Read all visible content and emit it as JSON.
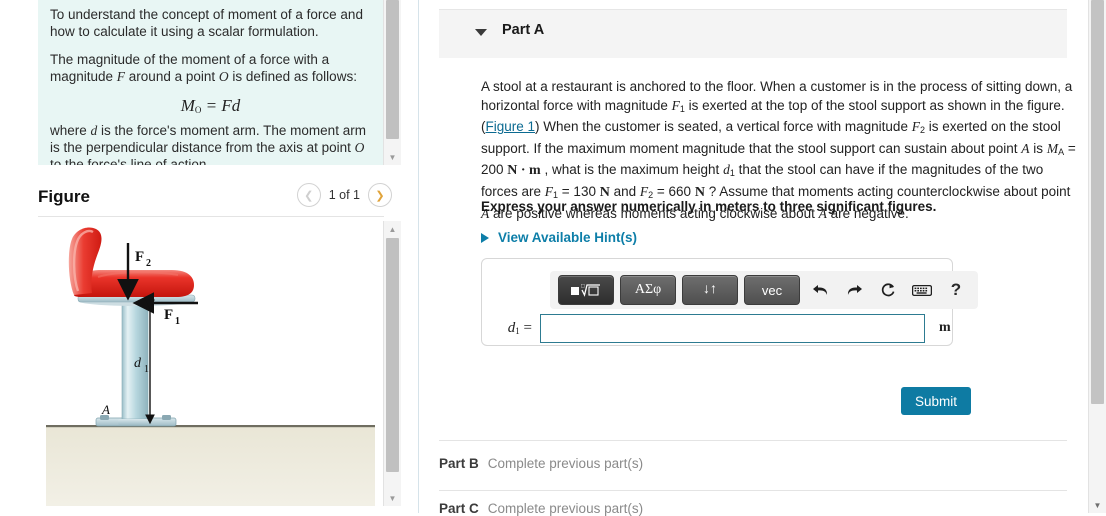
{
  "intro": {
    "objective": "To understand the concept of moment of a force and how to calculate it using a scalar formulation.",
    "definition_pre": "The magnitude of the moment of a force with a magnitude ",
    "definition_F": "F",
    "definition_mid": " around a point ",
    "definition_O": "O",
    "definition_post": " is defined as follows:",
    "equation": "M_O = Fd",
    "equation_M": "M",
    "equation_Osub": "O",
    "equation_rhs": "= Fd",
    "explanation_1": "where ",
    "explanation_d": "d",
    "explanation_2": " is the force's moment arm. The moment arm is the perpendicular distance from the axis at point ",
    "explanation_O": "O",
    "explanation_3": " to the force's line of action."
  },
  "figure": {
    "title": "Figure",
    "pager_label": "1 of 1",
    "prev_icon": "chevron-left-icon",
    "next_icon": "chevron-right-icon",
    "labels": {
      "force_2": "F",
      "force_2_sub": "2",
      "force_1": "F",
      "force_1_sub": "1",
      "distance": "d",
      "distance_sub": "1",
      "point": "A"
    },
    "colors": {
      "seat": "#e8291f",
      "seat_highlight": "#f06a60",
      "post": "#b9d8e0",
      "post_edge": "#8fb8c4",
      "floor": "#e6e3d3",
      "floor_line": "#7d7b6e"
    }
  },
  "partA": {
    "header_label": "Part A",
    "caret_icon": "caret-down-icon",
    "problem": {
      "s1": "A stool at a restaurant is anchored to the floor. When a customer is in the process of sitting down, a horizontal force with magnitude ",
      "F1a": "F",
      "F1a_sub": "1",
      "s2": " is exerted at the top of the stool support as shown in the figure. (",
      "figure_link": "Figure 1",
      "s3": ") When the customer is seated, a vertical force with magnitude ",
      "F2a": "F",
      "F2a_sub": "2",
      "s4": " is exerted on the stool support. If the maximum moment magnitude that the stool support can sustain about point ",
      "A1": "A",
      "s5": " is ",
      "MA": "M",
      "MA_sub": "A",
      "s6": " = 200 ",
      "unit_Nm": "N · m",
      "s7": " , what is the maximum height ",
      "d1": "d",
      "d1_sub": "1",
      "s8": " that the stool can have if the magnitudes of the two forces are ",
      "F1b": "F",
      "F1b_sub": "1",
      "s9": " = 130 ",
      "unit_N1": "N",
      "s10": " and ",
      "F2b": "F",
      "F2b_sub": "2",
      "s11": " = 660 ",
      "unit_N2": "N",
      "s12": " ?  Assume that moments acting counterclockwise about point ",
      "A2": "A",
      "s13": " are positive whereas moments acting clockwise about ",
      "A3": "A",
      "s14": " are negative."
    },
    "instruction": "Express your answer numerically in meters to three significant figures.",
    "hints_label": "View Available Hint(s)",
    "hints_caret_icon": "caret-right-icon",
    "toolbar": {
      "buttons": [
        {
          "name": "template-radical-button",
          "label": "■√□",
          "active": true
        },
        {
          "name": "greek-symbols-button",
          "label": "ΑΣφ",
          "active": false
        },
        {
          "name": "arrows-button",
          "label": "↓↑",
          "active": false
        },
        {
          "name": "vector-button",
          "label": "vec",
          "active": false
        }
      ],
      "icons": [
        {
          "name": "undo-icon",
          "glyph": "↶"
        },
        {
          "name": "redo-icon",
          "glyph": "↷"
        },
        {
          "name": "reset-icon",
          "glyph": "↺"
        },
        {
          "name": "keyboard-icon",
          "glyph": "⌨"
        },
        {
          "name": "help-icon",
          "glyph": "?"
        }
      ]
    },
    "answer": {
      "label_var": "d",
      "label_sub": "1",
      "label_eq": "=",
      "value": "",
      "placeholder": "",
      "unit": "m"
    },
    "submit_label": "Submit"
  },
  "other_parts": [
    {
      "name": "Part B",
      "status": "Complete previous part(s)"
    },
    {
      "name": "Part C",
      "status": "Complete previous part(s)"
    }
  ],
  "scrollbars": {
    "up_arrow": "▲",
    "down_arrow": "▼"
  }
}
